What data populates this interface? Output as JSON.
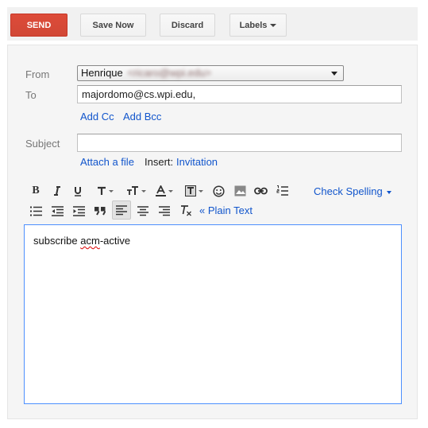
{
  "toolbar": {
    "send_label": "SEND",
    "save_label": "Save Now",
    "discard_label": "Discard",
    "labels_label": "Labels"
  },
  "compose": {
    "from_label": "From",
    "from_name": "Henrique",
    "from_email_obscured": "<ricaro@wpi.edu>",
    "to_label": "To",
    "to_value": "majordomo@cs.wpi.edu,",
    "add_cc": "Add Cc",
    "add_bcc": "Add Bcc",
    "subject_label": "Subject",
    "subject_value": "",
    "attach_file": "Attach a file",
    "insert_label": "Insert:",
    "invitation_link": "Invitation"
  },
  "formatting": {
    "icons": [
      "bold-icon",
      "italic-icon",
      "underline-icon",
      "font-icon",
      "font-size-icon",
      "text-color-icon",
      "highlight-icon",
      "emoji-icon",
      "image-icon",
      "link-icon",
      "numbered-list-icon",
      "bulleted-list-icon",
      "indent-less-icon",
      "indent-more-icon",
      "quote-icon",
      "align-left-icon",
      "align-center-icon",
      "align-right-icon",
      "remove-formatting-icon"
    ],
    "check_spelling": "Check Spelling",
    "plain_text": "« Plain Text"
  },
  "message": {
    "word1": "subscribe ",
    "word2": "acm",
    "word3": "-active"
  },
  "colors": {
    "send": "#d14836",
    "link": "#1155cc",
    "focus_border": "#4d90fe"
  }
}
